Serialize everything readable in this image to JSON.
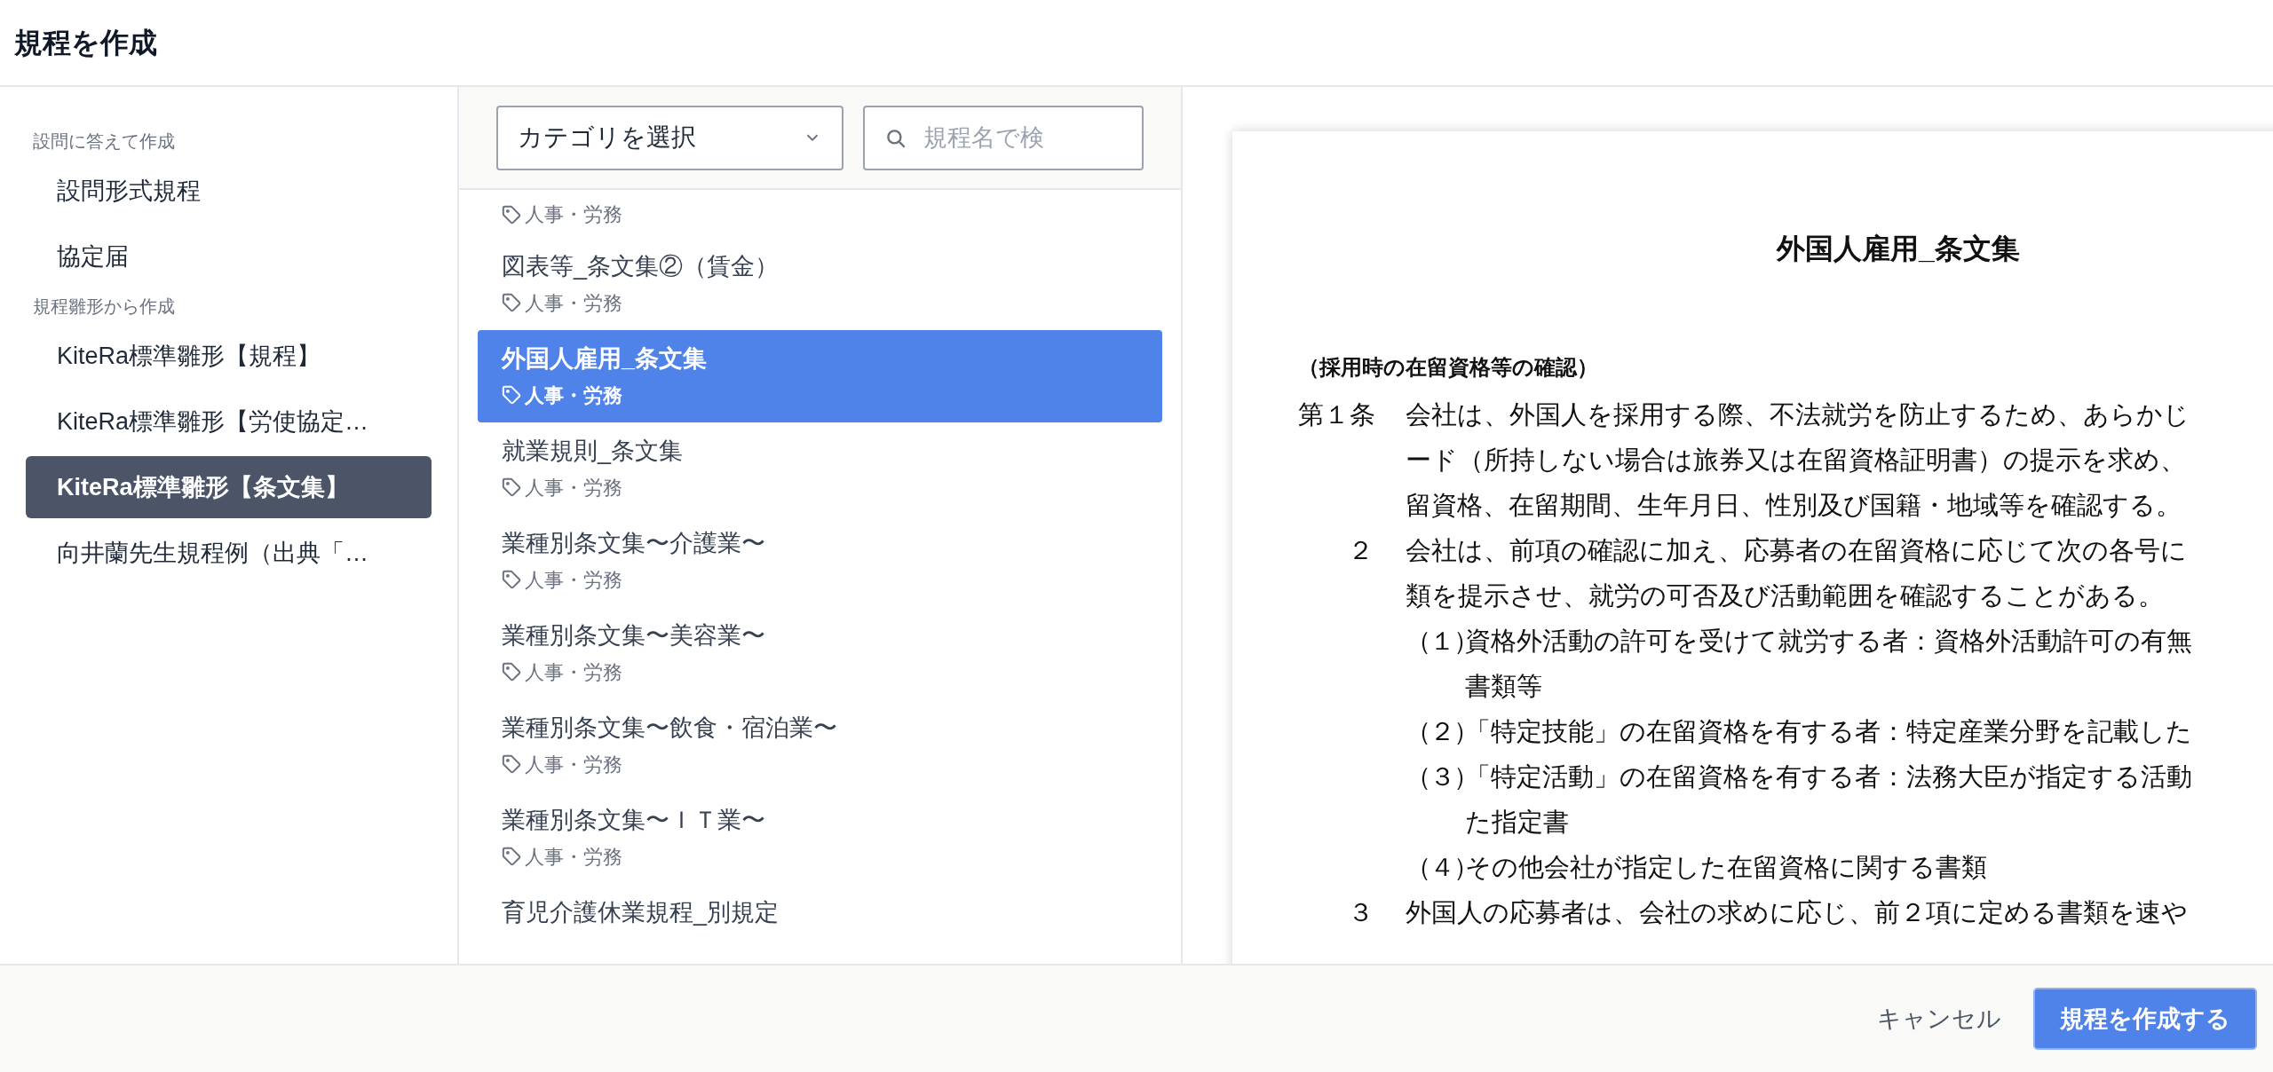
{
  "title": "規程を作成",
  "sidebar": {
    "sections": [
      {
        "label": "設問に答えて作成",
        "items": [
          {
            "label": "設問形式規程",
            "selected": false
          },
          {
            "label": "協定届",
            "selected": false
          }
        ]
      },
      {
        "label": "規程雛形から作成",
        "items": [
          {
            "label": "KiteRa標準雛形【規程】",
            "selected": false
          },
          {
            "label": "KiteRa標準雛形【労使協定…",
            "selected": false
          },
          {
            "label": "KiteRa標準雛形【条文集】",
            "selected": true
          },
          {
            "label": "向井蘭先生規程例（出典「…",
            "selected": false
          }
        ]
      }
    ]
  },
  "filter": {
    "category": {
      "placeholder": "カテゴリを選択"
    },
    "search": {
      "placeholder": "規程名で検"
    }
  },
  "templates": [
    {
      "tag": "人事・労務",
      "selected": false
    },
    {
      "title": "図表等_条文集②（賃金）",
      "tag": "人事・労務",
      "selected": false
    },
    {
      "title": "外国人雇用_条文集",
      "tag": "人事・労務",
      "selected": true
    },
    {
      "title": "就業規則_条文集",
      "tag": "人事・労務",
      "selected": false
    },
    {
      "title": "業種別条文集〜介護業〜",
      "tag": "人事・労務",
      "selected": false
    },
    {
      "title": "業種別条文集〜美容業〜",
      "tag": "人事・労務",
      "selected": false
    },
    {
      "title": "業種別条文集〜飲食・宿泊業〜",
      "tag": "人事・労務",
      "selected": false
    },
    {
      "title": "業種別条文集〜ＩＴ業〜",
      "tag": "人事・労務",
      "selected": false
    },
    {
      "title": "育児介護休業規程_別規定",
      "selected": false
    }
  ],
  "preview": {
    "title": "外国人雇用_条文集",
    "heading": "（採用時の在留資格等の確認）",
    "clauses": [
      {
        "kind": "article",
        "number": "第１条",
        "lines": [
          "会社は、外国人を採用する際、不法就労を防止するため、あらかじ",
          "ード（所持しない場合は旅券又は在留資格証明書）の提示を求め、",
          "留資格、在留期間、生年月日、性別及び国籍・地域等を確認する。"
        ]
      },
      {
        "kind": "paragraph",
        "number": "２",
        "lines": [
          "会社は、前項の確認に加え、応募者の在留資格に応じて次の各号に",
          "類を提示させ、就労の可否及び活動範囲を確認することがある。"
        ],
        "items": [
          {
            "number": "（１）",
            "lines": [
              "資格外活動の許可を受けて就労する者：資格外活動許可の有無",
              "書類等"
            ]
          },
          {
            "number": "（２）",
            "lines": [
              "「特定技能」の在留資格を有する者：特定産業分野を記載した"
            ]
          },
          {
            "number": "（３）",
            "lines": [
              "「特定活動」の在留資格を有する者：法務大臣が指定する活動",
              "た指定書"
            ]
          },
          {
            "number": "（４）",
            "lines": [
              "その他会社が指定した在留資格に関する書類"
            ]
          }
        ]
      },
      {
        "kind": "paragraph",
        "number": "３",
        "lines": [
          "外国人の応募者は、会社の求めに応じ、前２項に定める書類を速や"
        ]
      }
    ]
  },
  "footer": {
    "cancel": "キャンセル",
    "submit": "規程を作成する"
  }
}
